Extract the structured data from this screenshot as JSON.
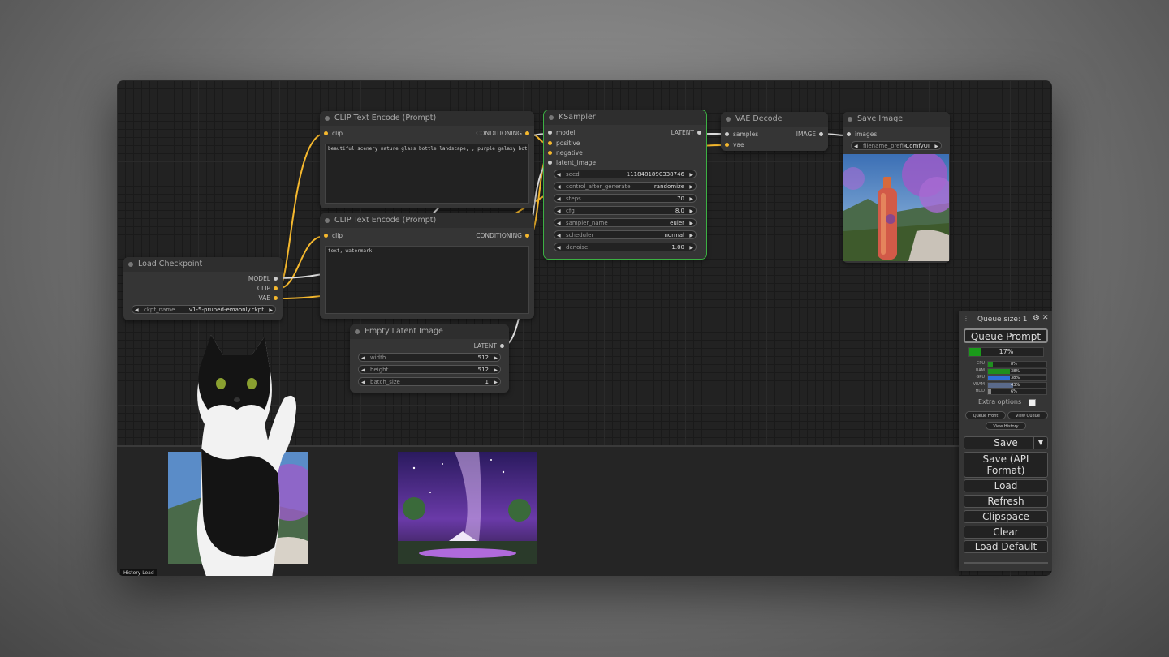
{
  "nodes": {
    "clip_pos": {
      "title": "CLIP Text Encode (Prompt)",
      "in_clip": "clip",
      "out": "CONDITIONING",
      "text": "beautiful scenery nature glass bottle landscape, , purple galaxy bottle,"
    },
    "clip_neg": {
      "title": "CLIP Text Encode (Prompt)",
      "in_clip": "clip",
      "out": "CONDITIONING",
      "text": "text, watermark"
    },
    "ksampler": {
      "title": "KSampler",
      "inputs": [
        "model",
        "positive",
        "negative",
        "latent_image"
      ],
      "out": "LATENT",
      "widgets": [
        {
          "label": "seed",
          "value": "1118481890338746"
        },
        {
          "label": "control_after_generate",
          "value": "randomize"
        },
        {
          "label": "steps",
          "value": "70"
        },
        {
          "label": "cfg",
          "value": "8.0"
        },
        {
          "label": "sampler_name",
          "value": "euler"
        },
        {
          "label": "scheduler",
          "value": "normal"
        },
        {
          "label": "denoise",
          "value": "1.00"
        }
      ]
    },
    "vae_decode": {
      "title": "VAE Decode",
      "in_samples": "samples",
      "in_vae": "vae",
      "out": "IMAGE"
    },
    "save_image": {
      "title": "Save Image",
      "in_images": "images",
      "prefix_label": "filename_prefix",
      "prefix_value": "ComfyUI"
    },
    "checkpoint": {
      "title": "Load Checkpoint",
      "out_model": "MODEL",
      "out_clip": "CLIP",
      "out_vae": "VAE",
      "ckpt_label": "ckpt_name",
      "ckpt_value": "v1-5-pruned-emaonly.ckpt"
    },
    "latent": {
      "title": "Empty Latent Image",
      "out": "LATENT",
      "widgets": [
        {
          "label": "width",
          "value": "512"
        },
        {
          "label": "height",
          "value": "512"
        },
        {
          "label": "batch_size",
          "value": "1"
        }
      ]
    }
  },
  "panel": {
    "queue_size": "Queue size: 1",
    "queue_prompt": "Queue Prompt",
    "progress": 17,
    "progress_label": "17%",
    "stats": [
      {
        "name": "CPU",
        "pct": 8,
        "label": "8%",
        "color": "#1f8f1f"
      },
      {
        "name": "RAM",
        "pct": 38,
        "label": "38%",
        "color": "#1f8f1f"
      },
      {
        "name": "GPU",
        "pct": 38,
        "label": "38%",
        "color": "#2e6fd8"
      },
      {
        "name": "VRAM",
        "pct": 43,
        "label": "43%",
        "color": "#5a6a8a"
      },
      {
        "name": "HDD",
        "pct": 5,
        "label": "6%",
        "color": "#888888"
      }
    ],
    "extra_options": "Extra options",
    "queue_front": "Queue Front",
    "view_queue": "View Queue",
    "view_history": "View History",
    "save": "Save",
    "save_api": "Save (API Format)",
    "load": "Load",
    "refresh": "Refresh",
    "clipspace": "Clipspace",
    "clear": "Clear",
    "load_default": "Load Default"
  },
  "footer_tab": "History Load",
  "colors": {
    "accent_green": "#3cb043",
    "link_yellow": "#f5b82e",
    "link_white": "#dddddd"
  }
}
